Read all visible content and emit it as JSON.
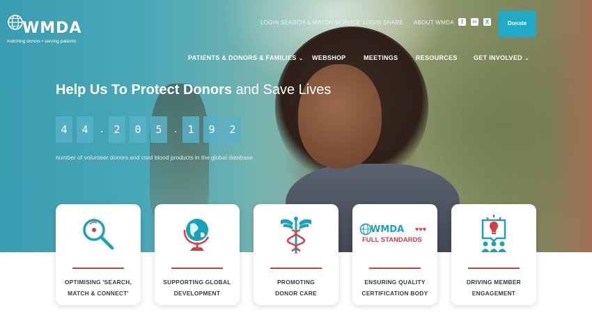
{
  "logo": {
    "name": "WMDA",
    "tagline": "matching donors • serving patients"
  },
  "top_links": [
    "LOGIN SEARCH & MATCH SERVICE",
    "LOGIN SHARE",
    "ABOUT WMDA"
  ],
  "social": [
    {
      "icon": "facebook-icon",
      "glyph": "f"
    },
    {
      "icon": "linkedin-icon",
      "glyph": "in"
    },
    {
      "icon": "x-twitter-icon",
      "glyph": "X"
    }
  ],
  "donate_label": "Donate",
  "nav": [
    {
      "label": "PATIENTS & DONORS & FAMILIES",
      "dropdown": true
    },
    {
      "label": "WEBSHOP",
      "dropdown": false
    },
    {
      "label": "MEETINGS",
      "dropdown": false
    },
    {
      "label": "RESOURCES",
      "dropdown": false
    },
    {
      "label": "GET INVOLVED",
      "dropdown": true
    }
  ],
  "hero": {
    "headline_bold": "Help Us To Protect Donors",
    "headline_light": "and Save Lives",
    "counter_digits": [
      "4",
      "4",
      "2",
      "0",
      "5",
      "1",
      "9",
      "2"
    ],
    "counter_separator": ".",
    "caption": "number of volunteer donors and cord blood products in the global database"
  },
  "cards": [
    {
      "icon": "magnifier-icon",
      "line1": "OPTIMISING 'SEARCH,",
      "line2": "MATCH & CONNECT'"
    },
    {
      "icon": "globe-icon",
      "line1": "SUPPORTING GLOBAL",
      "line2": "DEVELOPMENT"
    },
    {
      "icon": "caduceus-icon",
      "line1": "PROMOTING",
      "line2": "DONOR CARE"
    },
    {
      "icon": "wmda-standards-logo",
      "line1": "ENSURING QUALITY",
      "line2": "CERTIFICATION BODY",
      "logo_text": "WMDA",
      "logo_subtext": "FULL STANDARDS"
    },
    {
      "icon": "engagement-icon",
      "line1": "DRIVING MEMBER",
      "line2": "ENGAGEMENT"
    }
  ],
  "colors": {
    "accent": "#1faac7",
    "teal": "#1aa3b8",
    "red": "#d93a45",
    "text": "#3a3a3a"
  }
}
